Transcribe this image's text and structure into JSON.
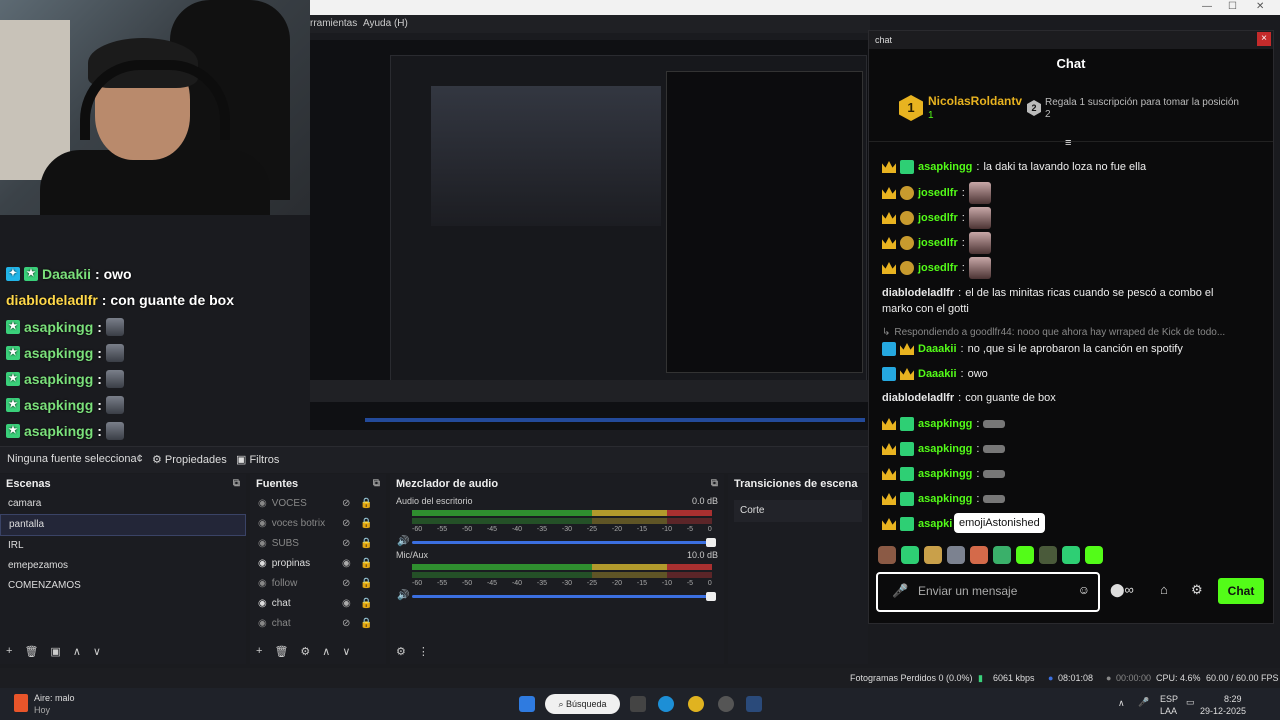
{
  "window": {
    "menu_tools": "rramientas",
    "menu_help": "Ayuda (H)",
    "controls": [
      "—",
      "☐",
      "✕"
    ]
  },
  "overlay": {
    "lines": [
      {
        "user": "Daaakii",
        "text": " : owo",
        "badges": 2
      },
      {
        "user": "diablodeladlfr",
        "text": " : con guante de box",
        "badges": 0
      },
      {
        "user": "asapkingg",
        "text": " :",
        "badges": 1
      },
      {
        "user": "asapkingg",
        "text": " :",
        "badges": 1
      },
      {
        "user": "asapkingg",
        "text": " :",
        "badges": 1
      },
      {
        "user": "asapkingg",
        "text": " :",
        "badges": 1
      },
      {
        "user": "asapkingg",
        "text": " :",
        "badges": 1
      }
    ]
  },
  "properties_bar": {
    "source_label": "Ninguna fuente selecciona¢",
    "properties": "Propiedades",
    "filters": "Filtros"
  },
  "scenes": {
    "title": "Escenas",
    "items": [
      "camara",
      "pantalla",
      "IRL",
      "emepezamos",
      "COMENZAMOS"
    ],
    "selected": 1
  },
  "sources": {
    "title": "Fuentes",
    "items": [
      {
        "label": "VOCES",
        "dim": true
      },
      {
        "label": "voces botrix",
        "dim": true
      },
      {
        "label": "SUBS",
        "dim": true
      },
      {
        "label": "propinas",
        "dim": false
      },
      {
        "label": "follow",
        "dim": true
      },
      {
        "label": "chat",
        "dim": false
      },
      {
        "label": "chat",
        "dim": true
      }
    ]
  },
  "mixer": {
    "title": "Mezclador de audio",
    "channels": [
      {
        "name": "Audio del escritorio",
        "db": "0.0 dB",
        "level": 0.98
      },
      {
        "name": "Mic/Aux",
        "db": "10.0 dB",
        "level": 0.98
      }
    ],
    "scale": [
      "-60",
      "-55",
      "-50",
      "-45",
      "-40",
      "-35",
      "-30",
      "-25",
      "-20",
      "-15",
      "-10",
      "-5",
      "0"
    ]
  },
  "transitions": {
    "title": "Transiciones de escena",
    "value": "Corte"
  },
  "chat": {
    "window_title": "chat",
    "title": "Chat",
    "leader": {
      "rank": "1",
      "name": "NicolasRoldantv",
      "sub": "1"
    },
    "gift": {
      "rank": "2",
      "text": "Regala 1 suscripción para tomar la posición 2"
    },
    "messages": [
      {
        "user": "asapkingg",
        "text": "la daki ta lavando loza no fue ella",
        "type": "text"
      },
      {
        "user": "josedlfr",
        "text": "",
        "type": "emote"
      },
      {
        "user": "josedlfr",
        "text": "",
        "type": "emote"
      },
      {
        "user": "josedlfr",
        "text": "",
        "type": "emote"
      },
      {
        "user": "josedlfr",
        "text": "",
        "type": "emote"
      },
      {
        "user": "diablodeladlfr",
        "text": "el de las minitas ricas cuando se pescó a combo el",
        "text2": "marko con el gotti",
        "type": "plain"
      },
      {
        "reply": "Respondiendo a goodlfr44: nooo que ahora hay wrraped de Kick de todo..."
      },
      {
        "user": "Daaakii",
        "text": "no ,que si le aprobaron la canción en spotify",
        "type": "daaki"
      },
      {
        "user": "Daaakii",
        "text": "owo",
        "type": "daaki"
      },
      {
        "user": "diablodeladlfr",
        "text": "con guante de box",
        "type": "plain"
      },
      {
        "user": "asapkingg",
        "text": "",
        "type": "bar"
      },
      {
        "user": "asapkingg",
        "text": "",
        "type": "bar"
      },
      {
        "user": "asapkingg",
        "text": "",
        "type": "bar"
      },
      {
        "user": "asapkingg",
        "text": "",
        "type": "bar"
      },
      {
        "user": "asapki",
        "text": "",
        "type": "bar"
      }
    ],
    "tooltip": "emojiAstonished",
    "input_placeholder": "Enviar un mensaje",
    "send": "Chat"
  },
  "status": {
    "dropped": "Fotogramas Perdidos 0 (0.0%)",
    "kbps": "6061 kbps",
    "time1": "08:01:08",
    "time2": "00:00:00",
    "cpu": "CPU: 4.6%",
    "fps": "60.00 / 60.00 FPS"
  },
  "taskbar": {
    "weather": "Aire: malo",
    "weather_sub": "Hoy",
    "search": "Búsqueda",
    "lang1": "ESP",
    "lang2": "LAA",
    "clock": "8:29",
    "date": "29-12-2025"
  }
}
